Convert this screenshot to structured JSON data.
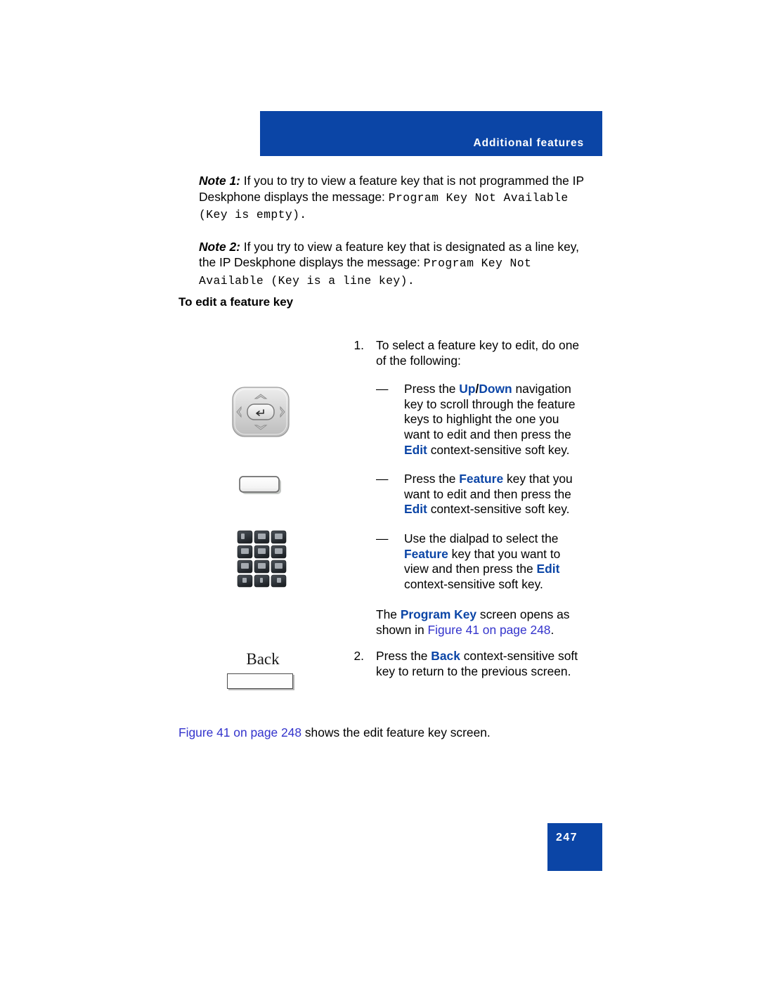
{
  "page": {
    "header_banner": "Additional features",
    "page_number": "247"
  },
  "notes": [
    {
      "label": "Note 1:",
      "text_before": " If you to try to view a feature key that is not programmed the IP Deskphone displays the message:",
      "mono_text": "Program Key Not Available (Key is empty)."
    },
    {
      "label": "Note 2:",
      "text_before": " If you try to view a feature key that is designated as a line key, the IP Deskphone displays the message:",
      "mono_text": "Program Key Not Available (Key is a line key)."
    }
  ],
  "section": {
    "heading": "To edit a feature key"
  },
  "steps": [
    {
      "number": "1.",
      "text": "To select a feature key to edit, do one of the following:",
      "sub_items": [
        {
          "dash": "—",
          "part1": "Press the ",
          "kw1": "Up",
          "sep": "/",
          "kw2": "Down",
          "part2": " navigation key to scroll through the feature keys to highlight the one you want to edit and then press the ",
          "kw3": "Edit",
          "part3": " context-sensitive soft key."
        },
        {
          "dash": "—",
          "part1": "Press the ",
          "kw1": "Feature",
          "part2": " key that you want to edit and then press the ",
          "kw3": "Edit",
          "part3": " context-sensitive soft key."
        },
        {
          "dash": "—",
          "part1": "Use the dialpad to select the ",
          "kw1": "Feature",
          "part2": " key that you want to view and then press the ",
          "kw3": "Edit",
          "part3": " context-sensitive soft key."
        }
      ],
      "program_note": {
        "part1": "The ",
        "kw": "Program Key",
        "part2": " screen opens as shown in ",
        "xref": "Figure 41 on page 248",
        "part3": "."
      }
    },
    {
      "number": "2.",
      "text_part1": "Press the ",
      "kw": "Back",
      "text_part2": " context-sensitive soft key to return to the previous screen."
    }
  ],
  "closing": {
    "xref": "Figure 41 on page 248",
    "text": " shows the edit feature key screen."
  },
  "graphics": {
    "navigation_key_caption": "navigation-cluster",
    "feature_key_caption": "feature-key",
    "dialpad_caption": "dialpad",
    "back_key_label": "Back"
  },
  "colors": {
    "banner_blue": "#0b45a6",
    "keyword_blue": "#0b45a6",
    "link_blue": "#3333cc"
  }
}
